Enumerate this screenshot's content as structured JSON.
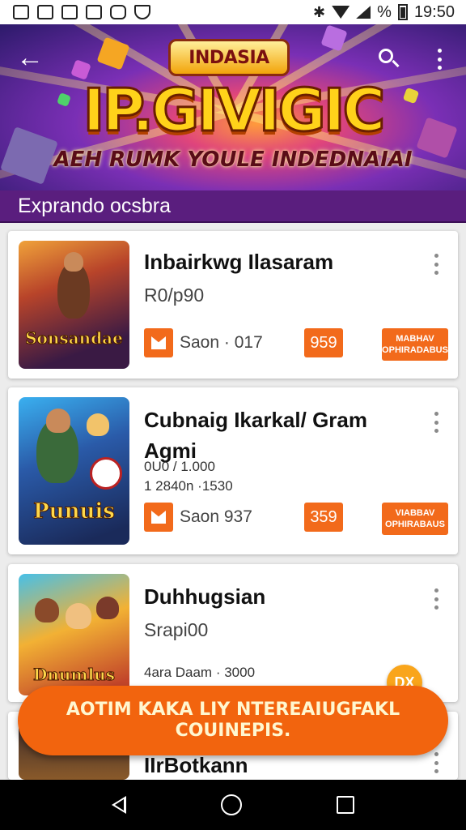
{
  "status_bar": {
    "battery_text": "%",
    "time": "19:50"
  },
  "banner": {
    "logo_text": "INDASIA",
    "title": "IP.GIVIGIC",
    "subtitle": "AEH RUMK YOULE INDEDNAIAI"
  },
  "section": {
    "label": "Exprando ocsbra"
  },
  "cards": [
    {
      "title": "Inbairkwg Ilasaram",
      "subtitle": "R0/p90",
      "meta_1": "",
      "meta_2": "",
      "rating": "Saon  · 017",
      "price": "959",
      "install_label": "MABHAV OPHIRADABUS",
      "thumb_text": "Sonsandae"
    },
    {
      "title": "Cubnaig Ikarkal/ Gram",
      "title_line2": "Agmi",
      "meta_1": "0U0 / 1.000",
      "meta_2": "1      2840n  ·1530",
      "rating": "Saon     937",
      "price": "359",
      "install_label": "VIABBAV OPHIRABAUS",
      "thumb_text": "Punuis"
    },
    {
      "title": "Duhhugsian",
      "subtitle": "Srapi00",
      "meta_1": "4ara  Daam  · 3000",
      "thumb_text": "Dnumlus"
    },
    {
      "title": "IIrBotkann"
    }
  ],
  "fab_mini": {
    "label": "DX"
  },
  "cta": {
    "label": "AOTIM KAKA LIY NTEREAIUGFAKL COUINEPIS."
  }
}
